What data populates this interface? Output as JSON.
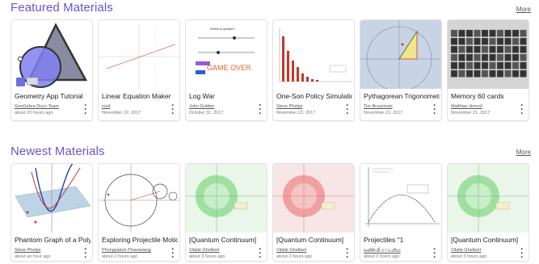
{
  "featured": {
    "title": "Featured Materials",
    "more": "More",
    "cards": [
      {
        "title": "Geometry App Tutorial",
        "author": "GeoGebra Docu Team",
        "date": "about 20 hours ago",
        "thumb": "geogebra-logo",
        "badge": "3.14"
      },
      {
        "title": "Linear Equation Maker",
        "author": "rosil",
        "date": "November 22, 2017",
        "thumb": "linear-graph"
      },
      {
        "title": "Log War",
        "author": "John Golden",
        "date": "October 31, 2017",
        "thumb": "game-over",
        "thumb_text": {
          "question": "Which is greater?",
          "game_over": "GAME OVER"
        }
      },
      {
        "title": "One-Son Policy Simulation",
        "author": "Steve Phelps",
        "date": "November 22, 2017",
        "thumb": "bar-chart"
      },
      {
        "title": "Pythagorean Trigonometry",
        "author": "Tim Brzezinski",
        "date": "November 22, 2017",
        "thumb": "triangle"
      },
      {
        "title": "Memory 60 cards",
        "author": "Matthias Hornof",
        "date": "November 21, 2017",
        "thumb": "card-grid"
      }
    ]
  },
  "newest": {
    "title": "Newest Materials",
    "more": "More",
    "cards": [
      {
        "title": "Phantom Graph of a Polynomial",
        "author": "Steve Phelps",
        "date": "about an hour ago",
        "thumb": "3d-graph"
      },
      {
        "title": "Exploring Projectile Motion",
        "author": "Phongsakon Phavasiang",
        "date": "about 2 hours ago",
        "thumb": "circles"
      },
      {
        "title": "[Quantum Continuum]",
        "author": "Vitalie Ghelbert",
        "date": "about 3 hours ago",
        "thumb": "green-target"
      },
      {
        "title": "[Quantum Continuum]",
        "author": "Vitalie Ghelbert",
        "date": "about 3 hours ago",
        "thumb": "red-target"
      },
      {
        "title": "Projectiles \"1",
        "author": "พงศ์ศักดิ์ ภาวะเสียง",
        "date": "about 3 hours ago",
        "thumb": "parabola"
      },
      {
        "title": "[Quantum Continuum]",
        "author": "Vitalie Ghelbert",
        "date": "about 3 hours ago",
        "thumb": "green-target"
      }
    ]
  },
  "colors": {
    "accent": "#6557d2",
    "geogebra_blue": "#7f7ff2"
  },
  "icons": {
    "menu": "kebab-menu-icon"
  }
}
